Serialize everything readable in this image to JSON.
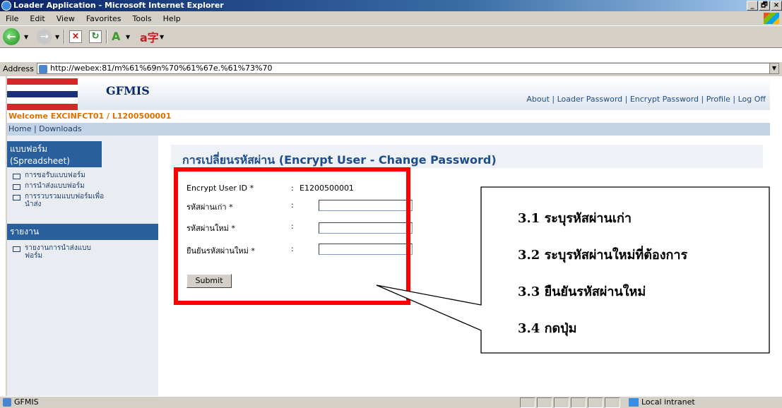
{
  "window": {
    "title": "Loader Application - Microsoft Internet Explorer",
    "buttons": [
      "_",
      "🗗",
      "×"
    ]
  },
  "menu": [
    "File",
    "Edit",
    "View",
    "Favorites",
    "Tools",
    "Help"
  ],
  "address": {
    "label": "Address",
    "url": "http://webex:81/m%61%69n%70%61%67e.%61%73%70"
  },
  "header": {
    "logo": "GFMIS",
    "links": "About | Loader Password | Encrypt Password | Profile | Log Off"
  },
  "welcome": "Welcome EXCINFCT01 / L1200500001",
  "nav": "Home | Downloads",
  "sidebar": {
    "section1_title": "แบบฟอร์ม (Spreadsheet)",
    "items": [
      "การขอรับแบบฟอร์ม",
      "การนำส่งแบบฟอร์ม",
      "การรวบรวมแบบฟอร์มเพื่อนำส่ง"
    ],
    "section2_title": "รายงาน",
    "report_items": [
      "รายงานการนำส่งแบบฟอร์ม"
    ]
  },
  "page": {
    "title": "การเปลี่ยนรหัสผ่าน (Encrypt User - Change Password)",
    "encrypt_user_label": "Encrypt User ID *",
    "encrypt_user_value": "E1200500001",
    "old_password_label": "รหัสผ่านเก่า *",
    "new_password_label": "รหัสผ่านใหม่ *",
    "confirm_password_label": "ยืนยันรหัสผ่านใหม่ *",
    "colon": ":",
    "submit_label": "Submit"
  },
  "callout": {
    "steps": [
      "3.1 ระบุรหัสผ่านเก่า",
      "3.2 ระบุรหัสผ่านใหม่ที่ต้องการ",
      "3.3 ยืนยันรหัสผ่านใหม่",
      "3.4 กดปุ่ม"
    ]
  },
  "status": {
    "text": "GFMIS",
    "zone": "Local intranet"
  },
  "colors": {
    "accent": "#1f4e8c",
    "highlight": "#ff0000",
    "welcome": "#e07000"
  }
}
